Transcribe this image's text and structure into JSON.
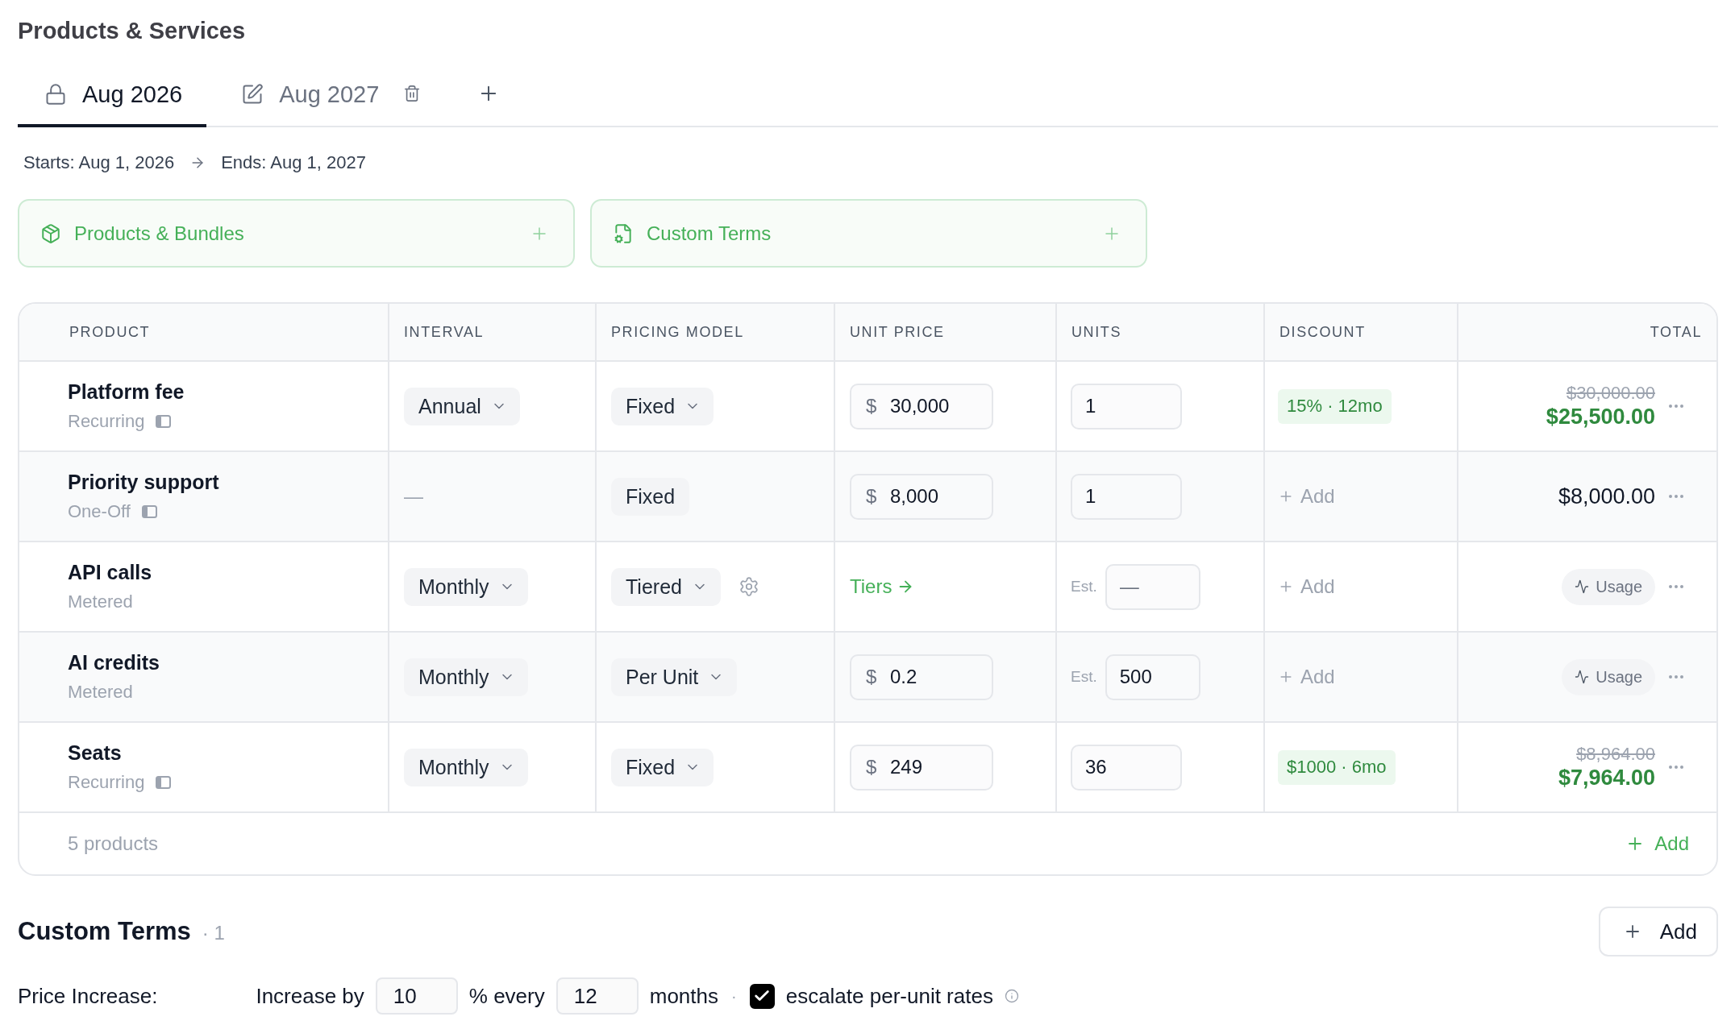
{
  "section_title": "Products & Services",
  "tabs": [
    {
      "label": "Aug 2026",
      "locked": true,
      "selected": true
    },
    {
      "label": "Aug 2027",
      "locked": false,
      "selected": false
    }
  ],
  "date_range": {
    "start": "Starts: Aug 1, 2026",
    "end": "Ends: Aug 1, 2027"
  },
  "add_panels": [
    {
      "kind": "products",
      "label": "Products & Bundles"
    },
    {
      "kind": "terms",
      "label": "Custom Terms"
    }
  ],
  "table": {
    "columns": [
      "PRODUCT",
      "INTERVAL",
      "PRICING MODEL",
      "UNIT PRICE",
      "UNITS",
      "DISCOUNT",
      "TOTAL"
    ],
    "rows": [
      {
        "name": "Platform fee",
        "type": "Recurring",
        "panel_icon": true,
        "interval": {
          "kind": "select",
          "value": "Annual"
        },
        "pricing": {
          "value": "Fixed",
          "dropdown": true,
          "settings": false
        },
        "unit_price": {
          "kind": "input",
          "currency": "$",
          "value": "30,000"
        },
        "units": {
          "value": "1"
        },
        "discount": {
          "kind": "badge",
          "text": "15% · 12mo"
        },
        "total": {
          "kind": "amount",
          "original": "$30,000.00",
          "amount": "$25,500.00"
        }
      },
      {
        "name": "Priority support",
        "type": "One-Off",
        "panel_icon": true,
        "interval": {
          "kind": "text",
          "value": "—"
        },
        "pricing": {
          "value": "Fixed",
          "dropdown": false,
          "settings": false
        },
        "unit_price": {
          "kind": "input",
          "currency": "$",
          "value": "8,000"
        },
        "units": {
          "value": "1"
        },
        "discount": {
          "kind": "add",
          "text": "Add"
        },
        "total": {
          "kind": "amount",
          "amount": "$8,000.00"
        }
      },
      {
        "name": "API calls",
        "type": "Metered",
        "panel_icon": false,
        "interval": {
          "kind": "select",
          "value": "Monthly"
        },
        "pricing": {
          "value": "Tiered",
          "dropdown": true,
          "settings": true
        },
        "unit_price": {
          "kind": "link",
          "value": "Tiers"
        },
        "units": {
          "label": "Est.",
          "placeholder": "—"
        },
        "discount": {
          "kind": "add",
          "text": "Add"
        },
        "total": {
          "kind": "usage",
          "text": "Usage"
        }
      },
      {
        "name": "AI credits",
        "type": "Metered",
        "panel_icon": false,
        "interval": {
          "kind": "select",
          "value": "Monthly"
        },
        "pricing": {
          "value": "Per Unit",
          "dropdown": true,
          "settings": false
        },
        "unit_price": {
          "kind": "input",
          "currency": "$",
          "value": "0.2"
        },
        "units": {
          "label": "Est.",
          "value": "500"
        },
        "discount": {
          "kind": "add",
          "text": "Add"
        },
        "total": {
          "kind": "usage",
          "text": "Usage"
        }
      },
      {
        "name": "Seats",
        "type": "Recurring",
        "panel_icon": true,
        "interval": {
          "kind": "select",
          "value": "Monthly"
        },
        "pricing": {
          "value": "Fixed",
          "dropdown": true,
          "settings": false
        },
        "unit_price": {
          "kind": "input",
          "currency": "$",
          "value": "249"
        },
        "units": {
          "value": "36"
        },
        "discount": {
          "kind": "badge",
          "text": "$1000 · 6mo"
        },
        "total": {
          "kind": "amount",
          "original": "$8,964.00",
          "amount": "$7,964.00"
        }
      }
    ],
    "footer": {
      "count": "5 products",
      "add": "Add"
    }
  },
  "custom_terms": {
    "title": "Custom Terms",
    "count": "· 1",
    "add": "Add",
    "price_increase": {
      "label": "Price Increase:",
      "prefix": "Increase by",
      "percent": "10",
      "between": "% every",
      "months": "12",
      "suffix": "months",
      "separator": "·",
      "escalate": {
        "checked": true,
        "label": "escalate per-unit rates"
      }
    }
  }
}
